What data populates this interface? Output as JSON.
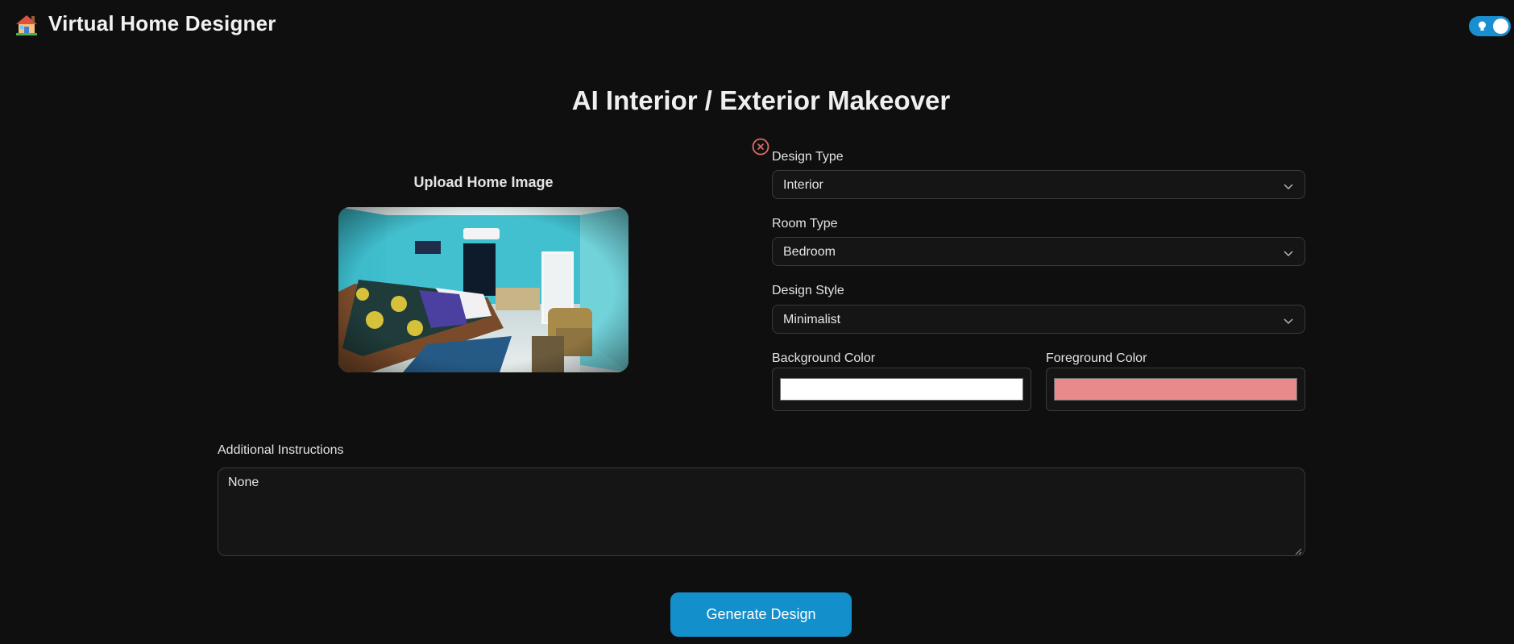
{
  "header": {
    "app_title": "Virtual Home Designer",
    "logo_icon": "house-icon",
    "theme_toggle_icon": "lightbulb-icon"
  },
  "main": {
    "title": "AI Interior / Exterior Makeover",
    "upload": {
      "label": "Upload Home Image",
      "remove_icon": "close-circle-icon"
    },
    "form": {
      "design_type": {
        "label": "Design Type",
        "value": "Interior"
      },
      "room_type": {
        "label": "Room Type",
        "value": "Bedroom"
      },
      "design_style": {
        "label": "Design Style",
        "value": "Minimalist"
      },
      "background_color": {
        "label": "Background Color",
        "value": "#ffffff"
      },
      "foreground_color": {
        "label": "Foreground Color",
        "value": "#e8898b"
      },
      "additional_instructions": {
        "label": "Additional Instructions",
        "value": "None"
      }
    },
    "generate_label": "Generate Design"
  },
  "colors": {
    "accent": "#138fcb",
    "background": "#0f0f0f",
    "remove_icon": "#e06a6a"
  }
}
